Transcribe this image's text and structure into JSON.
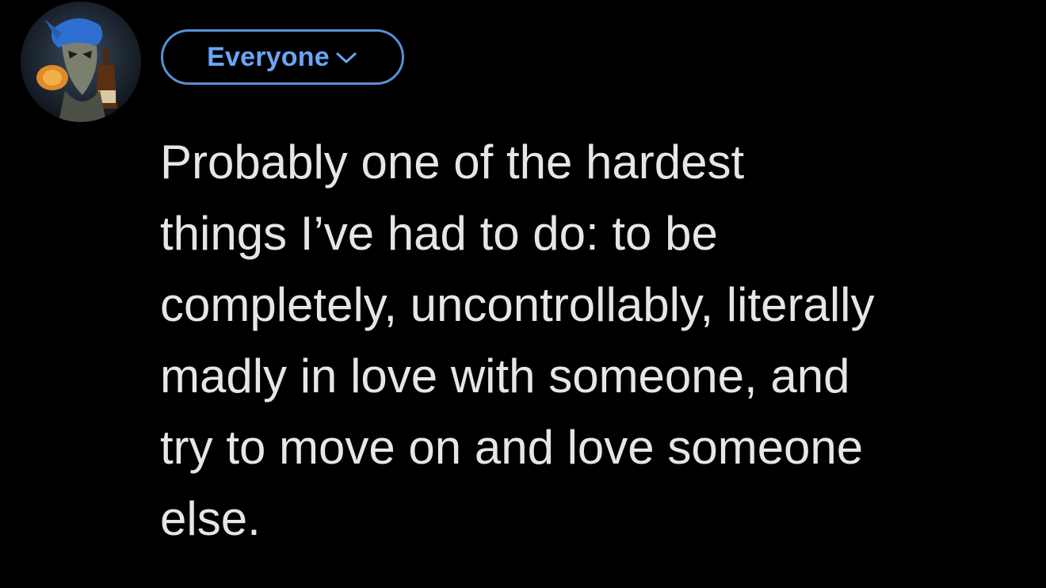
{
  "compose": {
    "avatar_icon": "profile-avatar-image",
    "audience": {
      "label": "Everyone",
      "icon": "chevron-down-icon",
      "accent_color": "#5a8fd6"
    },
    "post": {
      "lines": [
        "Probably one of the hardest",
        "things I’ve had to do: to be",
        "completely, uncontrollably, literally",
        "madly in love with someone, and",
        "try to move on and love someone",
        "else."
      ]
    }
  },
  "theme": {
    "background": "#000000",
    "text_color": "#e6e6e6"
  }
}
